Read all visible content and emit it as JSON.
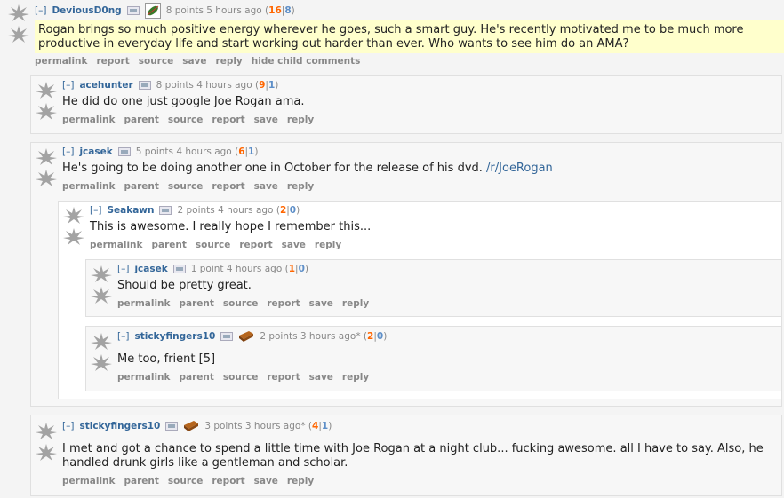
{
  "comments": [
    {
      "toggle": "[–]",
      "author": "DeviousD0ng",
      "points": "8 points 5 hours ago",
      "up": "16",
      "down": "8",
      "body": "Rogan brings so much positive energy wherever he goes, such a smart guy. He's recently motivated me to be much more productive in everyday life and start working out harder than ever. Who wants to see him do an AMA?",
      "actions": [
        "permalink",
        "report",
        "source",
        "save",
        "reply",
        "hide child comments"
      ]
    },
    {
      "toggle": "[–]",
      "author": "acehunter",
      "points": "8 points 4 hours ago",
      "up": "9",
      "down": "1",
      "body": "He did do one just google Joe Rogan ama.",
      "actions": [
        "permalink",
        "parent",
        "source",
        "report",
        "save",
        "reply"
      ]
    },
    {
      "toggle": "[–]",
      "author": "jcasek",
      "points": "5 points 4 hours ago",
      "up": "6",
      "down": "1",
      "body": "He's going to be doing another one in October for the release of his dvd.",
      "link": "/r/JoeRogan",
      "actions": [
        "permalink",
        "parent",
        "source",
        "report",
        "save",
        "reply"
      ]
    },
    {
      "toggle": "[–]",
      "author": "Seakawn",
      "points": "2 points 4 hours ago",
      "up": "2",
      "down": "0",
      "body": "This is awesome. I really hope I remember this...",
      "actions": [
        "permalink",
        "parent",
        "source",
        "report",
        "save",
        "reply"
      ]
    },
    {
      "toggle": "[–]",
      "author": "jcasek",
      "points": "1 point 4 hours ago",
      "up": "1",
      "down": "0",
      "body": "Should be pretty great.",
      "actions": [
        "permalink",
        "parent",
        "source",
        "report",
        "save",
        "reply"
      ]
    },
    {
      "toggle": "[–]",
      "author": "stickyfingers10",
      "points": "2 points 3 hours ago*",
      "up": "2",
      "down": "0",
      "body": "Me too, frient [5]",
      "actions": [
        "permalink",
        "parent",
        "source",
        "report",
        "save",
        "reply"
      ]
    },
    {
      "toggle": "[–]",
      "author": "stickyfingers10",
      "points": "3 points 3 hours ago*",
      "up": "4",
      "down": "1",
      "body": "I met and got a chance to spend a little time with Joe Rogan at a night club... fucking awesome. all I have to say. Also, he handled drunk girls like a gentleman and scholar.",
      "actions": [
        "permalink",
        "parent",
        "source",
        "report",
        "save",
        "reply"
      ]
    }
  ],
  "colors": {
    "author": "#336699",
    "upvotes": "#ff6600",
    "downvotes": "#5e8fc8",
    "highlight": "#ffffcc"
  }
}
